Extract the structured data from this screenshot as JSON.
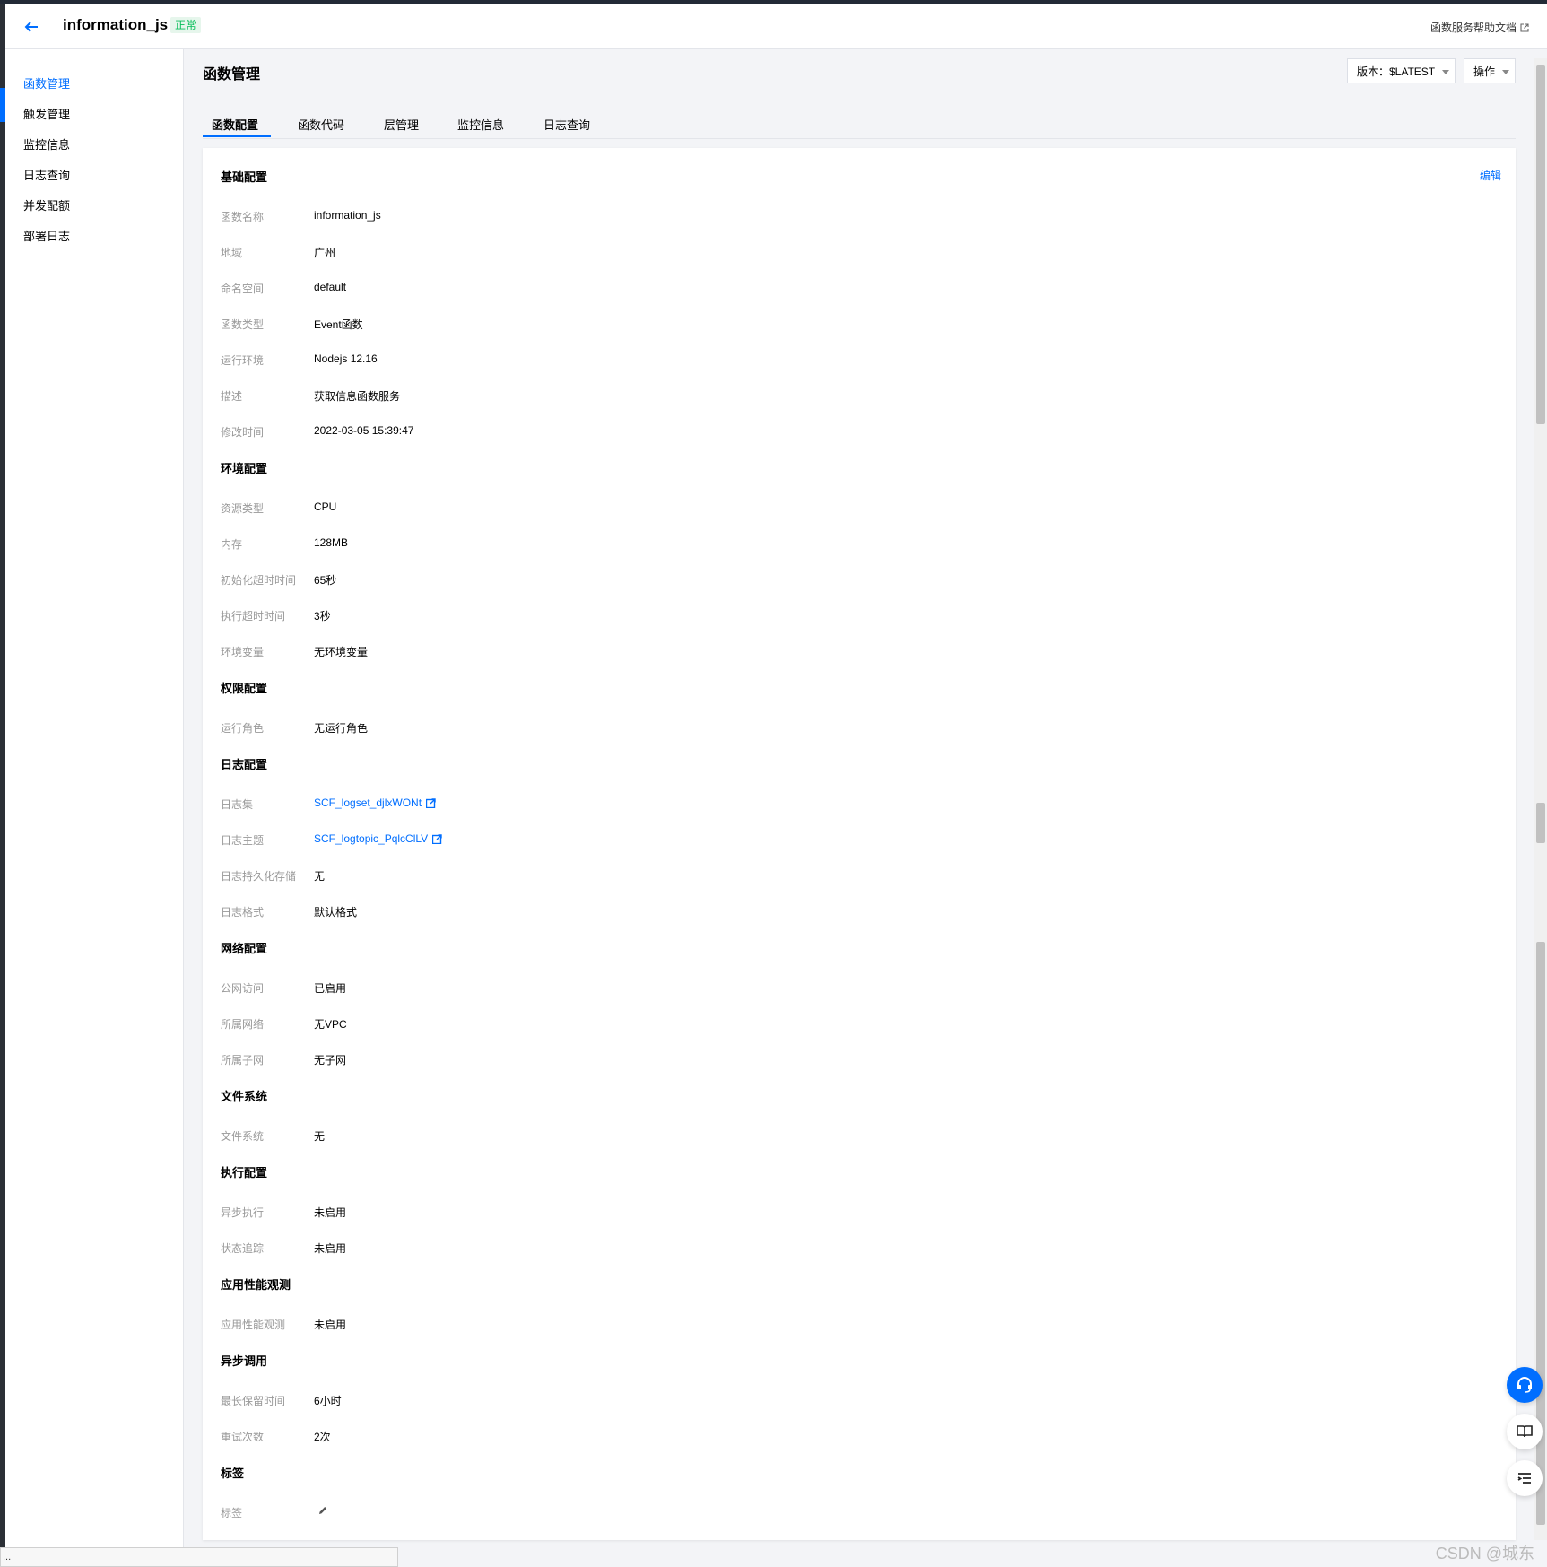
{
  "header": {
    "function_name": "information_js",
    "status": "正常",
    "help_link": "函数服务帮助文档"
  },
  "sidebar": {
    "items": [
      {
        "label": "函数管理",
        "active": true
      },
      {
        "label": "触发管理"
      },
      {
        "label": "监控信息"
      },
      {
        "label": "日志查询"
      },
      {
        "label": "并发配额"
      },
      {
        "label": "部署日志"
      }
    ]
  },
  "main": {
    "title": "函数管理",
    "version_button": "版本：$LATEST",
    "actions_button": "操作",
    "tabs": [
      {
        "label": "函数配置",
        "active": true
      },
      {
        "label": "函数代码"
      },
      {
        "label": "层管理"
      },
      {
        "label": "监控信息"
      },
      {
        "label": "日志查询"
      }
    ],
    "edit_link": "编辑"
  },
  "config": {
    "basic": {
      "title": "基础配置",
      "rows": [
        {
          "label": "函数名称",
          "value": "information_js"
        },
        {
          "label": "地域",
          "value": "广州"
        },
        {
          "label": "命名空间",
          "value": "default"
        },
        {
          "label": "函数类型",
          "value": "Event函数"
        },
        {
          "label": "运行环境",
          "value": "Nodejs 12.16"
        },
        {
          "label": "描述",
          "value": "获取信息函数服务"
        },
        {
          "label": "修改时间",
          "value": "2022-03-05 15:39:47"
        }
      ]
    },
    "env": {
      "title": "环境配置",
      "rows": [
        {
          "label": "资源类型",
          "value": "CPU"
        },
        {
          "label": "内存",
          "value": "128MB"
        },
        {
          "label": "初始化超时时间",
          "value": "65秒"
        },
        {
          "label": "执行超时时间",
          "value": "3秒"
        },
        {
          "label": "环境变量",
          "value": "无环境变量"
        }
      ]
    },
    "permission": {
      "title": "权限配置",
      "rows": [
        {
          "label": "运行角色",
          "value": "无运行角色"
        }
      ]
    },
    "log": {
      "title": "日志配置",
      "rows": [
        {
          "label": "日志集",
          "value": "SCF_logset_djlxWONt"
        },
        {
          "label": "日志主题",
          "value": "SCF_logtopic_PqlcClLV"
        },
        {
          "label": "日志持久化存储",
          "value": "无"
        },
        {
          "label": "日志格式",
          "value": "默认格式"
        }
      ]
    },
    "network": {
      "title": "网络配置",
      "rows": [
        {
          "label": "公网访问",
          "value": "已启用"
        },
        {
          "label": "所属网络",
          "value": "无VPC"
        },
        {
          "label": "所属子网",
          "value": "无子网"
        }
      ]
    },
    "filesystem": {
      "title": "文件系统",
      "rows": [
        {
          "label": "文件系统",
          "value": "无"
        }
      ]
    },
    "execution": {
      "title": "执行配置",
      "rows": [
        {
          "label": "异步执行",
          "value": "未启用"
        },
        {
          "label": "状态追踪",
          "value": "未启用"
        }
      ]
    },
    "apm": {
      "title": "应用性能观测",
      "rows": [
        {
          "label": "应用性能观测",
          "value": "未启用"
        }
      ]
    },
    "async": {
      "title": "异步调用",
      "rows": [
        {
          "label": "最长保留时间",
          "value": "6小时"
        },
        {
          "label": "重试次数",
          "value": "2次"
        }
      ]
    },
    "tags": {
      "title": "标签",
      "rows": [
        {
          "label": "标签",
          "value": ""
        }
      ]
    }
  },
  "icons": {
    "back": "arrow-left-icon",
    "external": "external-link-icon",
    "pencil": "pencil-icon",
    "float": [
      "headset-icon",
      "book-icon",
      "list-icon"
    ]
  },
  "colors": {
    "accent": "#006eff",
    "status_bg": "#e6f6ec",
    "status_text": "#0abf5b"
  },
  "statusbar": "...",
  "watermark": "CSDN @城东"
}
